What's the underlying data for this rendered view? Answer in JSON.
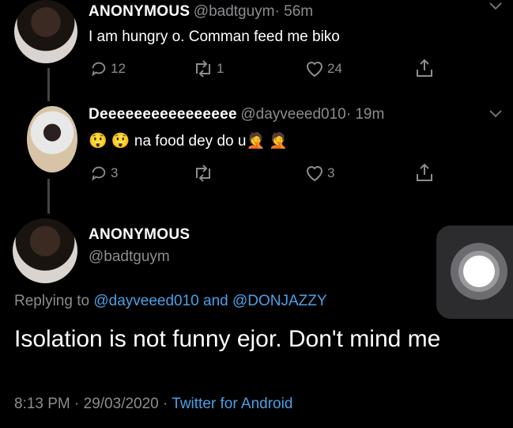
{
  "tweet1": {
    "name": "ANONYMOUS",
    "handle": "@badtguym",
    "time": "· 56m",
    "text": "I am hungry o. Comman feed me biko",
    "replies": "12",
    "retweets": "1",
    "likes": "24"
  },
  "tweet2": {
    "name": "Deeeeeeeeeeeeeeee",
    "handle": "@dayveeed010",
    "time": "· 19m",
    "emoji_before": "😲 😲",
    "text": "na food dey do u",
    "emoji_after": "🤦 🤦",
    "replies": "3",
    "likes": "3"
  },
  "main": {
    "name": "ANONYMOUS",
    "handle": "@badtguym",
    "replying_prefix": "Replying to",
    "reply_to_1": "@dayveeed010",
    "reply_and": "and",
    "reply_to_2": "@DONJAZZY",
    "text": "Isolation is not funny ejor. Don't mind me",
    "timestamp": "8:13 PM · 29/03/2020 ·",
    "source": "Twitter for Android"
  },
  "icons": {
    "reply": "reply-icon",
    "retweet": "retweet-icon",
    "like": "heart-icon",
    "share": "share-icon",
    "chevron": "chevron-down-icon",
    "assistive_touch": "assistive-touch-icon"
  },
  "colors": {
    "background": "#000000",
    "muted": "#8a8d91",
    "link": "#4aa0e6"
  }
}
